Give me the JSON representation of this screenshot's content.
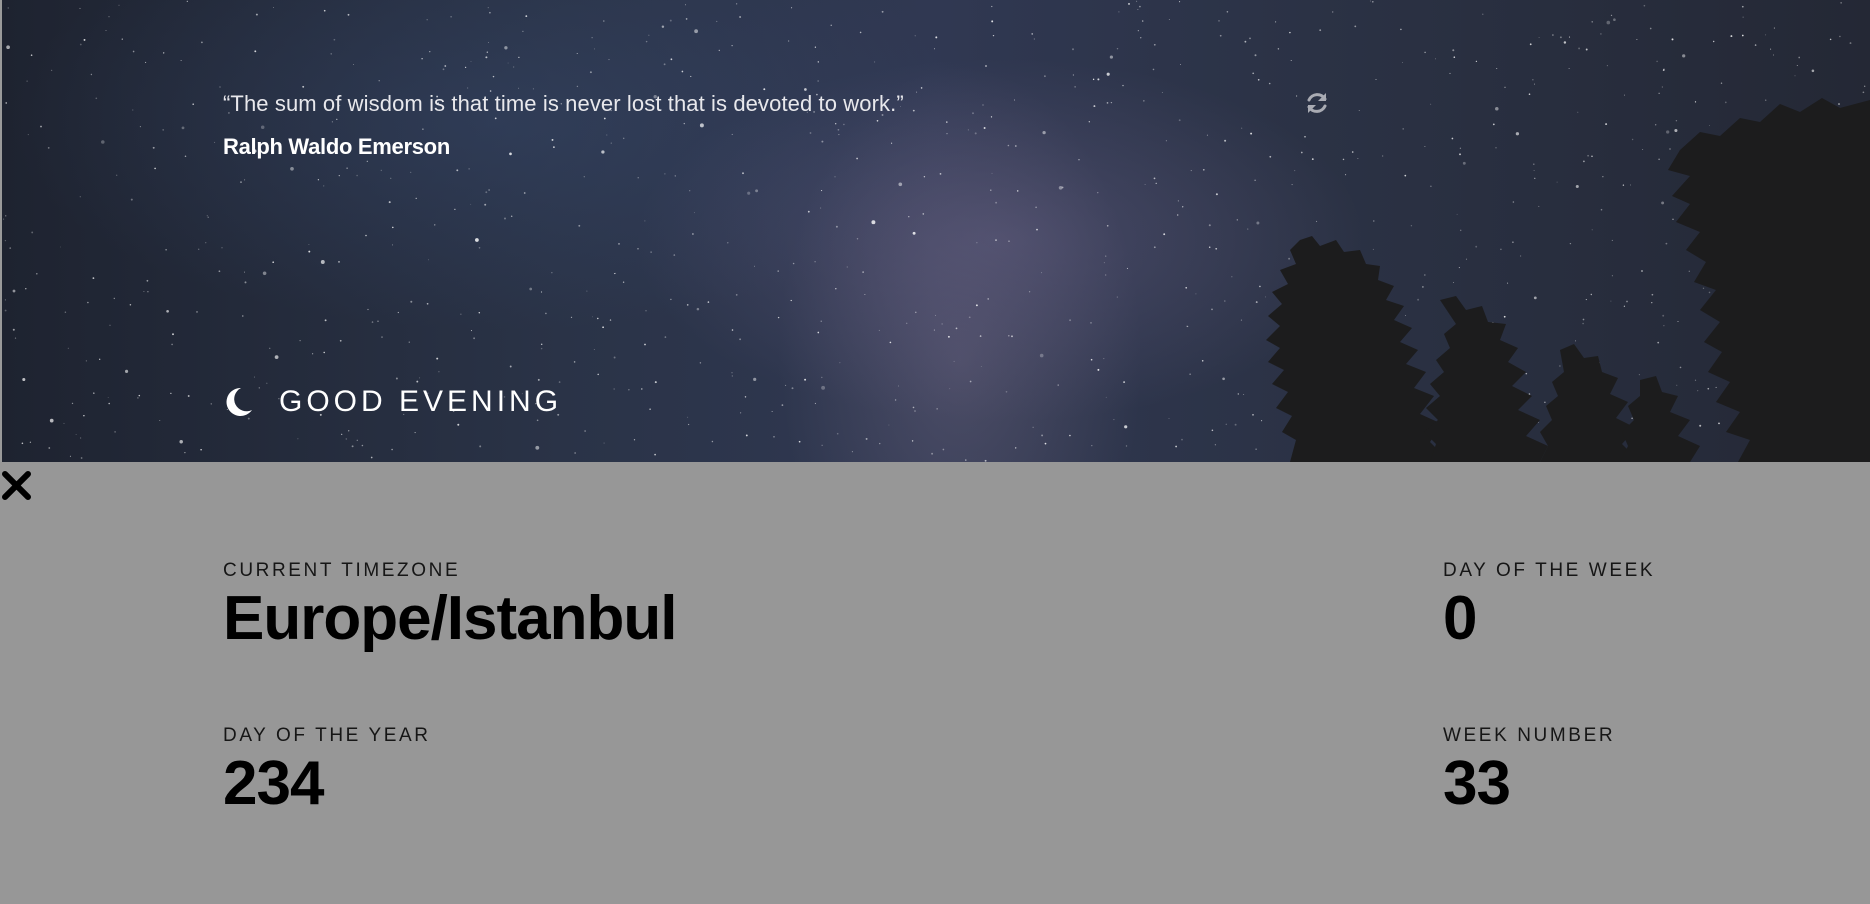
{
  "quote": {
    "text": "“The sum of wisdom is that time is never lost that is devoted to work.”",
    "author": "Ralph Waldo Emerson",
    "refresh_icon": "refresh-icon"
  },
  "greeting": {
    "icon": "moon-icon",
    "text": "GOOD EVENING"
  },
  "details": {
    "close_icon": "close-icon",
    "timezone_label": "CURRENT TIMEZONE",
    "timezone_value": "Europe/Istanbul",
    "day_of_week_label": "DAY OF THE WEEK",
    "day_of_week_value": "0",
    "day_of_year_label": "DAY OF THE YEAR",
    "day_of_year_value": "234",
    "week_number_label": "WEEK NUMBER",
    "week_number_value": "33"
  },
  "colors": {
    "panel_background": "#979797",
    "hero_sky": "#2a3347",
    "text_light": "#ffffff",
    "text_dark": "#000000"
  }
}
